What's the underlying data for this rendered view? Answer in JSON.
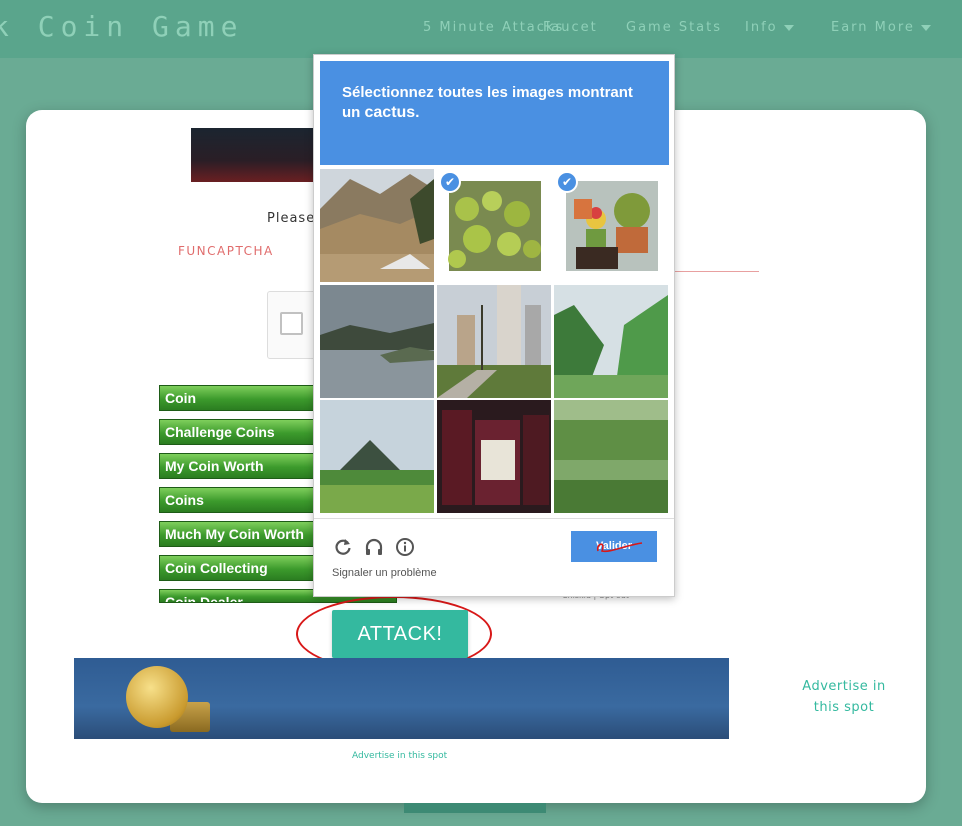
{
  "nav": {
    "brand": "k Coin Game",
    "items": [
      {
        "label": "5 Minute Attacks"
      },
      {
        "label": "Faucet"
      },
      {
        "label": "Game Stats"
      },
      {
        "label": "Info"
      },
      {
        "label": "Earn More"
      }
    ]
  },
  "main": {
    "please_text": "Please",
    "funcaptcha_label": "FUNCAPTCHA",
    "coin_buttons": [
      "Coin",
      "Challenge Coins",
      "My Coin Worth",
      "Coins",
      "Much My Coin Worth",
      "Coin Collecting",
      "Coin Dealer"
    ],
    "tiny_links": "Chiskid  |  Opt out",
    "attack_label": "ATTACK!",
    "ad_right": "Advertise in this spot",
    "ad_small": "Advertise in this spot"
  },
  "captcha": {
    "instruction_prefix": "Sélectionnez toutes les images montrant un ",
    "instruction_target": "cactus",
    "instruction_suffix": ".",
    "tiles": [
      {
        "desc": "mountain-landscape",
        "selected": false
      },
      {
        "desc": "cactus-field",
        "selected": true
      },
      {
        "desc": "potted-cactus",
        "selected": true
      },
      {
        "desc": "river",
        "selected": false
      },
      {
        "desc": "city-park",
        "selected": false
      },
      {
        "desc": "valley",
        "selected": false
      },
      {
        "desc": "mountain-hill",
        "selected": false
      },
      {
        "desc": "jars-shelf",
        "selected": false
      },
      {
        "desc": "green-field",
        "selected": false
      }
    ],
    "report_label": "Signaler un problème",
    "submit_label": "Valider",
    "colors": {
      "accent": "#4a90e2"
    }
  }
}
